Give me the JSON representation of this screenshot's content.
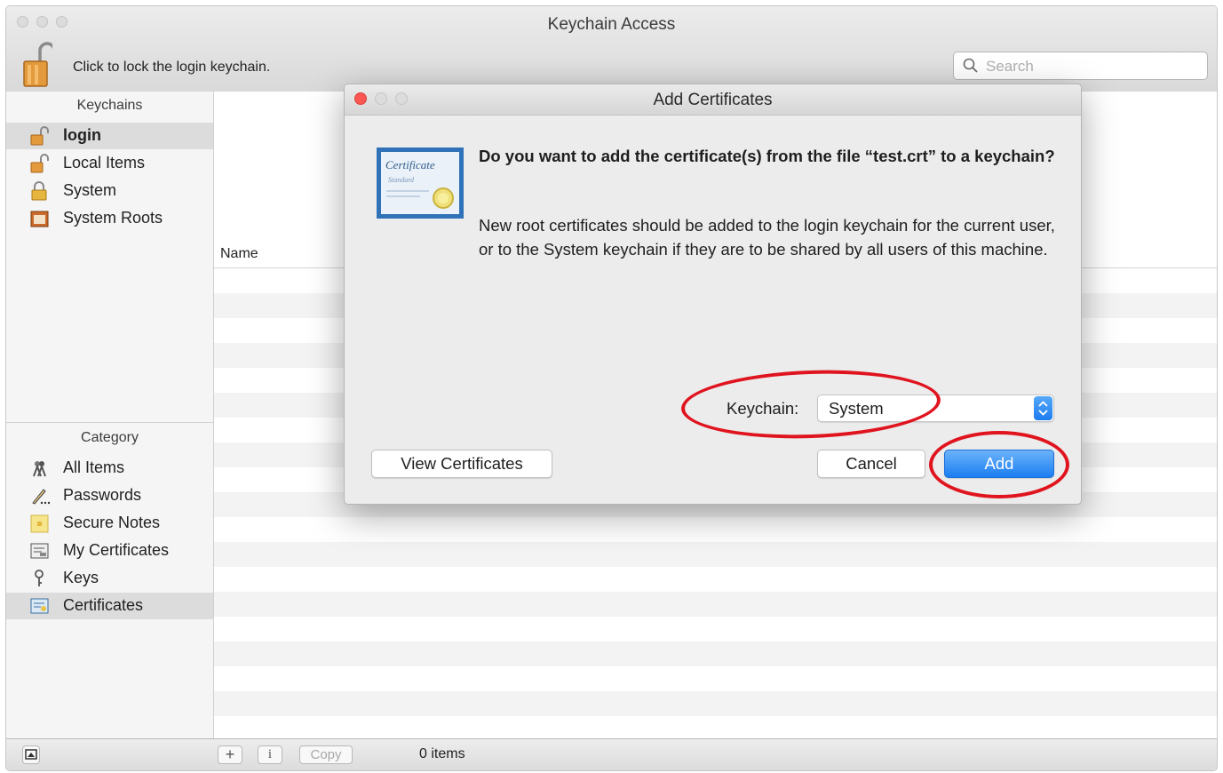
{
  "window": {
    "title": "Keychain Access"
  },
  "toolbar": {
    "lock_label": "Click to lock the login keychain.",
    "search_placeholder": "Search"
  },
  "sidebar": {
    "keychains_header": "Keychains",
    "keychains": [
      {
        "label": "login",
        "icon": "unlocked-padlock-icon",
        "selected": true
      },
      {
        "label": "Local Items",
        "icon": "unlocked-padlock-icon",
        "selected": false
      },
      {
        "label": "System",
        "icon": "locked-padlock-icon",
        "selected": false
      },
      {
        "label": "System Roots",
        "icon": "cabinet-icon",
        "selected": false
      }
    ],
    "category_header": "Category",
    "categories": [
      {
        "label": "All Items",
        "icon": "all-items-icon",
        "selected": false
      },
      {
        "label": "Passwords",
        "icon": "pen-icon",
        "selected": false
      },
      {
        "label": "Secure Notes",
        "icon": "note-icon",
        "selected": false
      },
      {
        "label": "My Certificates",
        "icon": "certificate-icon",
        "selected": false
      },
      {
        "label": "Keys",
        "icon": "key-icon",
        "selected": false
      },
      {
        "label": "Certificates",
        "icon": "certificate-icon",
        "selected": true
      }
    ]
  },
  "list": {
    "name_column": "Name"
  },
  "bottombar": {
    "copy_label": "Copy",
    "status": "0 items"
  },
  "dialog": {
    "title": "Add Certificates",
    "heading": "Do you want to add the certificate(s) from the file “test.crt” to a keychain?",
    "body": "New root certificates should be added to the login keychain for the current user, or to the System keychain if they are to be shared by all users of this machine.",
    "icon_text": [
      "Certificate",
      "Standard"
    ],
    "keychain_label": "Keychain:",
    "keychain_value": "System",
    "view_button": "View Certificates",
    "cancel_button": "Cancel",
    "add_button": "Add"
  },
  "colors": {
    "accent_blue": "#1b7ef1",
    "annotation_red": "#e0141e",
    "close_red": "#fc5753"
  }
}
